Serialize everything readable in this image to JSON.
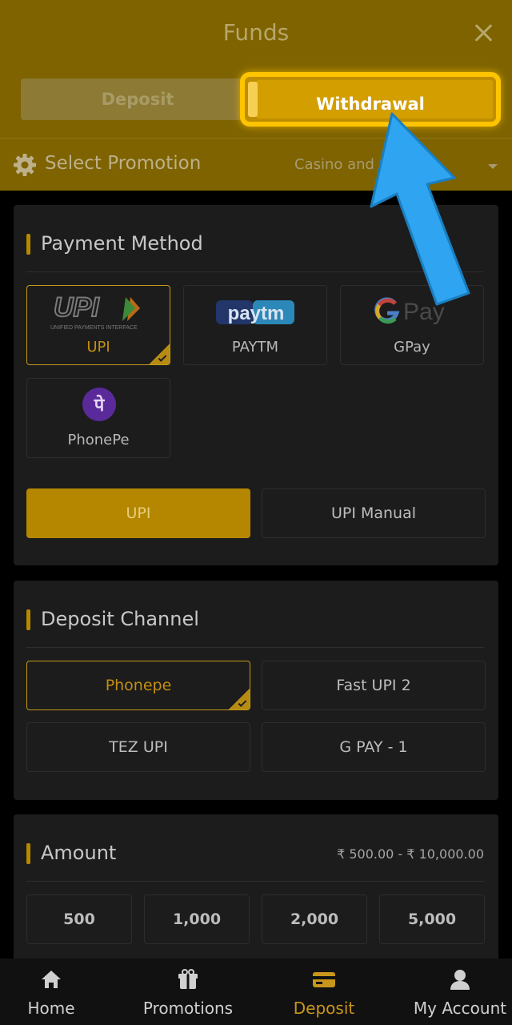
{
  "header": {
    "title": "Funds",
    "tabs": [
      {
        "label": "Deposit",
        "active": false
      },
      {
        "label": "Withdrawal",
        "active": true
      }
    ]
  },
  "promotion": {
    "label": "Select Promotion",
    "selected": "Casino and Sports"
  },
  "payment_method": {
    "title": "Payment Method",
    "options": [
      {
        "label": "UPI",
        "selected": true,
        "logo": "upi-logo"
      },
      {
        "label": "PAYTM",
        "selected": false,
        "logo": "paytm-logo"
      },
      {
        "label": "GPay",
        "selected": false,
        "logo": "gpay-logo"
      },
      {
        "label": "PhonePe",
        "selected": false,
        "logo": "phonepe-logo"
      }
    ],
    "logo_text": {
      "upi": "UPI",
      "upi_sub": "UNIFIED PAYMENTS INTERFACE",
      "paytm": "paytm",
      "gpay": "Pay",
      "phonepe": "पे"
    },
    "modes": [
      {
        "label": "UPI",
        "selected": true
      },
      {
        "label": "UPI Manual",
        "selected": false
      }
    ]
  },
  "deposit_channel": {
    "title": "Deposit Channel",
    "options": [
      {
        "label": "Phonepe",
        "selected": true
      },
      {
        "label": "Fast UPI 2",
        "selected": false
      },
      {
        "label": "TEZ UPI",
        "selected": false
      },
      {
        "label": "G PAY - 1",
        "selected": false
      }
    ]
  },
  "amount": {
    "title": "Amount",
    "range": "₹ 500.00 - ₹ 10,000.00",
    "presets": [
      "500",
      "1,000",
      "2,000",
      "5,000"
    ]
  },
  "bottom_nav": [
    {
      "label": "Home",
      "icon": "home-icon",
      "active": false
    },
    {
      "label": "Promotions",
      "icon": "gift-icon",
      "active": false
    },
    {
      "label": "Deposit",
      "icon": "card-icon",
      "active": true
    },
    {
      "label": "My Account",
      "icon": "user-icon",
      "active": false
    }
  ],
  "colors": {
    "accent": "#b58700",
    "highlight": "#ffc400",
    "annotation_arrow": "#2fa4f0"
  }
}
